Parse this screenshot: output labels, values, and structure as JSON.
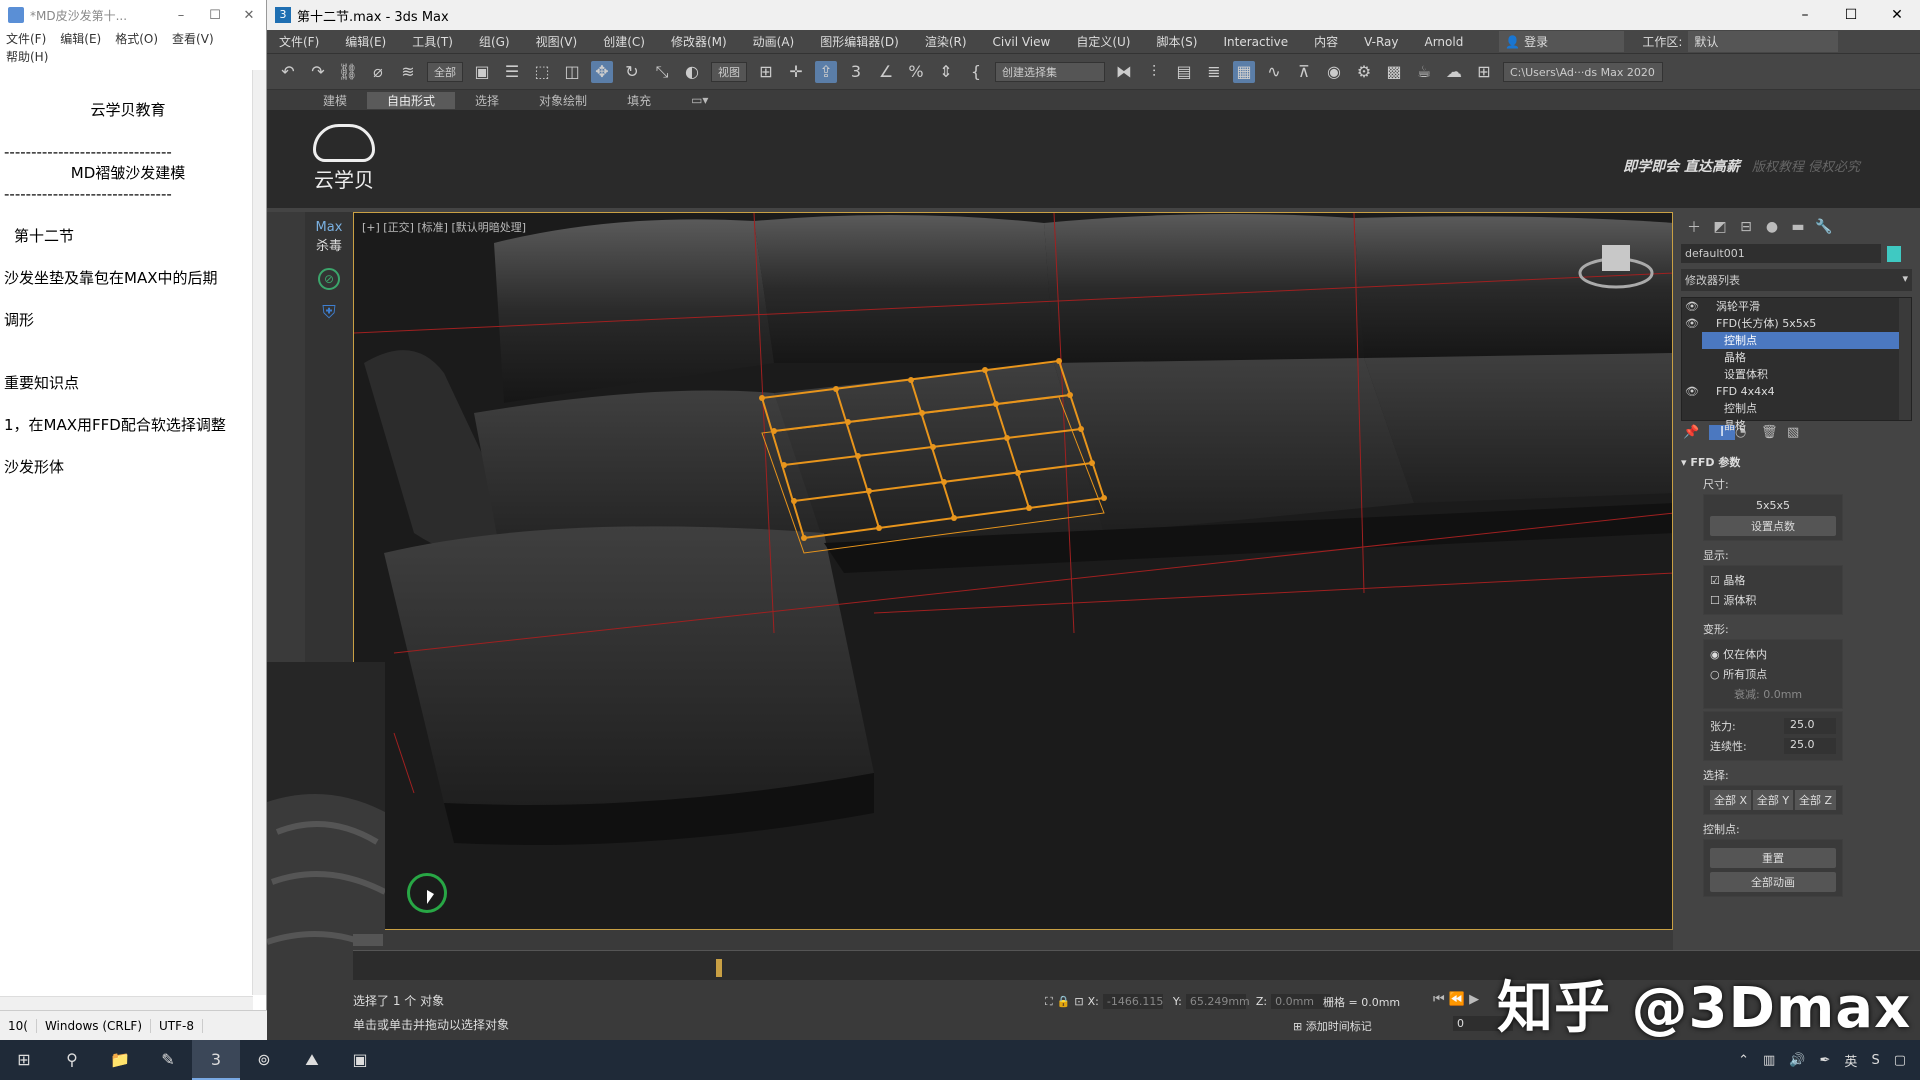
{
  "notepad": {
    "title": "*MD皮沙发第十...",
    "menu": [
      "文件(F)",
      "编辑(E)",
      "格式(O)",
      "查看(V)",
      "帮助(H)"
    ],
    "lines": {
      "l1": "云学贝教育",
      "dash": "-------------------------------",
      "l2": "MD褶皱沙发建模",
      "l3": "第十二节",
      "l4": "沙发坐垫及靠包在MAX中的后期",
      "l5": "调形",
      "l6": "重要知识点",
      "l7": "1，在MAX用FFD配合软选择调整",
      "l8": "沙发形体"
    },
    "status": [
      "10(",
      "Windows (CRLF)",
      "UTF-8"
    ]
  },
  "max": {
    "title": "第十二节.max - 3ds Max",
    "menu": [
      "文件(F)",
      "编辑(E)",
      "工具(T)",
      "组(G)",
      "视图(V)",
      "创建(C)",
      "修改器(M)",
      "动画(A)",
      "图形编辑器(D)",
      "渲染(R)",
      "Civil View",
      "自定义(U)",
      "脚本(S)",
      "Interactive",
      "内容",
      "V-Ray",
      "Arnold"
    ],
    "login": "登录",
    "workspace_label": "工作区:",
    "workspace_value": "默认",
    "toolbar": {
      "filter": "全部",
      "refcoord": "视图",
      "selset": "创建选择集",
      "path": "C:\\Users\\Ad···ds Max 2020"
    },
    "ribbon": [
      "建模",
      "自由形式",
      "选择",
      "对象绘制",
      "填充"
    ],
    "brand": {
      "name": "云学贝",
      "slogan": "即学即会  直达高薪",
      "slogan2": "版权教程  侵权必究"
    },
    "side": {
      "max": "Max",
      "label": "杀毒"
    },
    "viewport_label": "[+] [正交] [标准] [默认明暗处理]",
    "command_panel": {
      "object_name": "default001",
      "modifier_list": "修改器列表",
      "stack": [
        {
          "label": "涡轮平滑",
          "indent": 1,
          "sel": false
        },
        {
          "label": "FFD(长方体) 5x5x5",
          "indent": 1,
          "sel": false
        },
        {
          "label": "控制点",
          "indent": 2,
          "sel": true
        },
        {
          "label": "晶格",
          "indent": 2,
          "sel": false
        },
        {
          "label": "设置体积",
          "indent": 2,
          "sel": false
        },
        {
          "label": "FFD 4x4x4",
          "indent": 1,
          "sel": false
        },
        {
          "label": "控制点",
          "indent": 2,
          "sel": false
        },
        {
          "label": "晶格",
          "indent": 2,
          "sel": false
        }
      ],
      "ffd": {
        "header": "FFD 参数",
        "size_label": "尺寸:",
        "size_value": "5x5x5",
        "set_points": "设置点数",
        "display_label": "显示:",
        "lattice": "晶格",
        "source_volume": "源体积",
        "deform_label": "变形:",
        "inside_only": "仅在体内",
        "all_vertices": "所有顶点",
        "falloff": "衰减: 0.0mm",
        "tension_label": "张力:",
        "tension_value": "25.0",
        "continuity_label": "连续性:",
        "continuity_value": "25.0",
        "select_label": "选择:",
        "all_x": "全部 X",
        "all_y": "全部 Y",
        "all_z": "全部 Z",
        "ctrl_label": "控制点:",
        "reset": "重置",
        "animate_all": "全部动画"
      }
    },
    "status": {
      "line1": "选择了 1 个 对象",
      "line2": "单击或单击并拖动以选择对象",
      "x_label": "X:",
      "x_value": "-1466.115",
      "y_label": "Y:",
      "y_value": "65.249mm",
      "z_label": "Z:",
      "z_value": "0.0mm",
      "grid": "栅格 = 0.0mm",
      "add_time_tag": "添加时间标记",
      "frame": "0"
    }
  },
  "watermark": "知乎 @3Dmax",
  "taskbar": {
    "tray_lang": "英"
  }
}
